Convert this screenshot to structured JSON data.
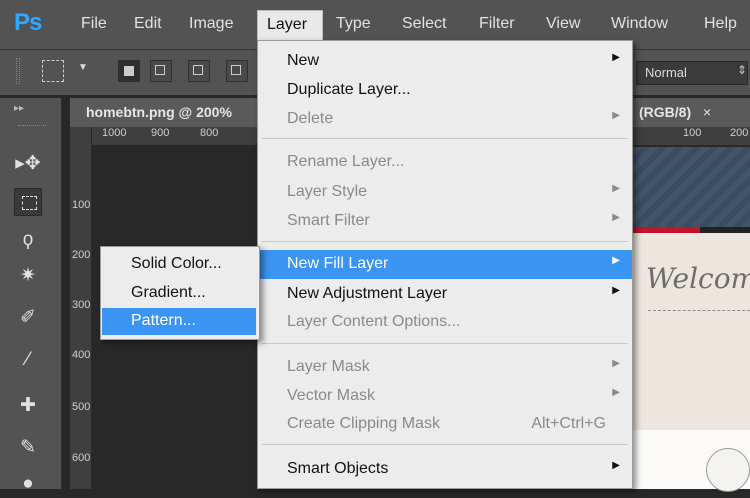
{
  "app": {
    "logo": "Ps"
  },
  "menubar": {
    "items": [
      "File",
      "Edit",
      "Image",
      "Layer",
      "Type",
      "Select",
      "Filter",
      "View",
      "Window",
      "Help"
    ]
  },
  "options": {
    "blend_mode": "Normal"
  },
  "tabs": {
    "left": "homebtn.png @ 200%",
    "right": "(RGB/8)",
    "close": "×"
  },
  "ruler": {
    "top": [
      "1000",
      "900",
      "800",
      "100",
      "200"
    ],
    "left": [
      "100",
      "200",
      "300",
      "400",
      "500",
      "600"
    ]
  },
  "canvas": {
    "welcome": "Welcome"
  },
  "layer_menu": {
    "items": [
      {
        "label": "New",
        "submenu": true,
        "disabled": false
      },
      {
        "label": "Duplicate Layer...",
        "submenu": false,
        "disabled": false
      },
      {
        "label": "Delete",
        "submenu": true,
        "disabled": true
      },
      {
        "label": "Rename Layer...",
        "submenu": false,
        "disabled": true
      },
      {
        "label": "Layer Style",
        "submenu": true,
        "disabled": true
      },
      {
        "label": "Smart Filter",
        "submenu": true,
        "disabled": true
      },
      {
        "label": "New Fill Layer",
        "submenu": true,
        "disabled": false,
        "selected": true
      },
      {
        "label": "New Adjustment Layer",
        "submenu": true,
        "disabled": false
      },
      {
        "label": "Layer Content Options...",
        "submenu": false,
        "disabled": true
      },
      {
        "label": "Layer Mask",
        "submenu": true,
        "disabled": true
      },
      {
        "label": "Vector Mask",
        "submenu": true,
        "disabled": true
      },
      {
        "label": "Create Clipping Mask",
        "shortcut": "Alt+Ctrl+G",
        "disabled": true
      },
      {
        "label": "Smart Objects",
        "submenu": true,
        "disabled": false
      }
    ]
  },
  "fill_submenu": {
    "items": [
      {
        "label": "Solid Color..."
      },
      {
        "label": "Gradient..."
      },
      {
        "label": "Pattern...",
        "selected": true
      }
    ]
  },
  "colors": {
    "accent": "#3a94f2",
    "menu_bg": "#ececec",
    "chrome": "#535353"
  }
}
